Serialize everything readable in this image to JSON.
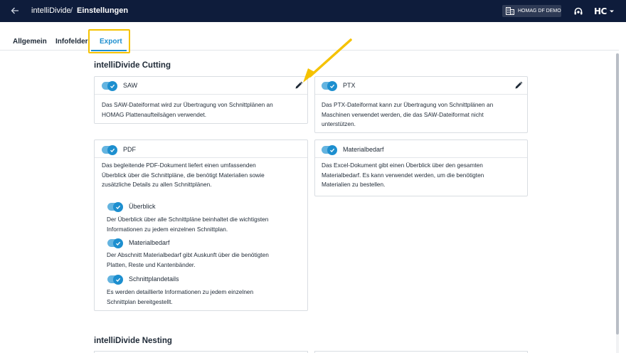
{
  "topbar": {
    "app_name": "intelliDivide",
    "separator": "/",
    "page_title": "Einstellungen",
    "tenant": "HOMAG DF DEMO",
    "logo": "HC",
    "icons": {
      "back": "arrow-left-icon",
      "tenant": "building-icon",
      "help": "headset-icon",
      "menu": "chevron-down-icon"
    }
  },
  "tabs": [
    {
      "label": "Allgemein",
      "active": false
    },
    {
      "label": "Infofelder",
      "active": false
    },
    {
      "label": "Export",
      "active": true
    }
  ],
  "colors": {
    "header_bg": "#0e1c3b",
    "accent": "#1d8fcf",
    "highlight": "#f5c200"
  },
  "sections": [
    {
      "title": "intelliDivide Cutting",
      "cards": [
        {
          "label": "SAW",
          "enabled": true,
          "editable": true,
          "description": [
            "Das SAW-Dateiformat wird zur Übertragung von Schnittplänen an",
            "HOMAG Plattenaufteilsägen verwendet."
          ]
        },
        {
          "label": "PTX",
          "enabled": true,
          "editable": true,
          "description": [
            "Das PTX-Dateiformat kann zur Übertragung von Schnittplänen an",
            "Maschinen verwendet werden, die das SAW-Dateiformat nicht",
            "unterstützen."
          ]
        },
        {
          "label": "PDF",
          "enabled": true,
          "editable": false,
          "description": [
            "Das begleitende PDF-Dokument liefert einen umfassenden",
            "Überblick über die Schnittpläne, die benötigt Materialien sowie",
            "zusätzliche Details zu allen Schnittplänen."
          ],
          "options": [
            {
              "label": "Überblick",
              "enabled": true,
              "description": [
                "Der Überblick über alle Schnittpläne beinhaltet die wichtigsten",
                "Informationen zu jedem einzelnen Schnittplan."
              ]
            },
            {
              "label": "Materialbedarf",
              "enabled": true,
              "description": [
                "Der Abschnitt Materialbedarf gibt Auskunft über die benötigten",
                "Platten, Reste und Kantenbänder."
              ]
            },
            {
              "label": "Schnittplandetails",
              "enabled": true,
              "description": [
                "Es werden detaillierte Informationen zu jedem einzelnen",
                "Schnittplan bereitgestellt."
              ]
            }
          ]
        },
        {
          "label": "Materialbedarf",
          "enabled": true,
          "editable": false,
          "description": [
            "Das Excel-Dokument gibt einen Überblick über den gesamten",
            "Materialbedarf. Es kann verwendet werden, um die benötigten",
            "Materialien zu bestellen."
          ]
        }
      ]
    },
    {
      "title": "intelliDivide Nesting",
      "cards": []
    }
  ]
}
